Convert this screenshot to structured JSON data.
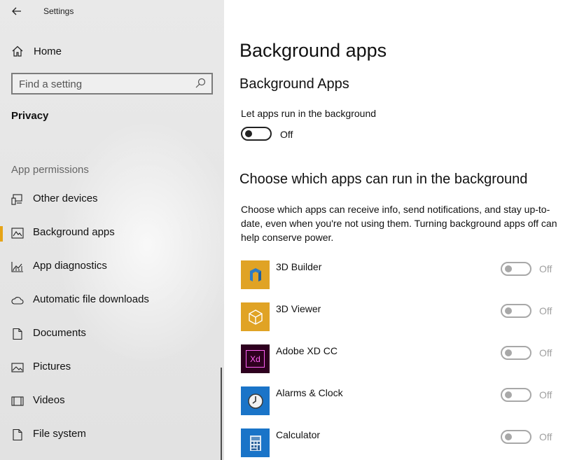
{
  "window": {
    "title": "Settings"
  },
  "sidebar": {
    "home_label": "Home",
    "search": {
      "placeholder": "Find a setting"
    },
    "section_title": "Privacy",
    "group_label": "App permissions",
    "items": [
      {
        "label": "Other devices",
        "icon": "devices-icon",
        "active": false
      },
      {
        "label": "Background apps",
        "icon": "background-apps-icon",
        "active": true
      },
      {
        "label": "App diagnostics",
        "icon": "diagnostics-icon",
        "active": false
      },
      {
        "label": "Automatic file downloads",
        "icon": "cloud-icon",
        "active": false
      },
      {
        "label": "Documents",
        "icon": "document-icon",
        "active": false
      },
      {
        "label": "Pictures",
        "icon": "picture-icon",
        "active": false
      },
      {
        "label": "Videos",
        "icon": "video-icon",
        "active": false
      },
      {
        "label": "File system",
        "icon": "file-icon",
        "active": false
      }
    ],
    "accent_color": "#e6a417"
  },
  "main": {
    "page_title": "Background apps",
    "section1": {
      "heading": "Background Apps",
      "setting_label": "Let apps run in the background",
      "toggle_state": "Off"
    },
    "section2": {
      "heading": "Choose which apps can run in the background",
      "description": "Choose which apps can receive info, send notifications, and stay up-to-date, even when you're not using them. Turning background apps off can help conserve power."
    },
    "apps": [
      {
        "name": "3D Builder",
        "state": "Off",
        "tile_color": "#e0a325",
        "icon": "3d-builder-icon"
      },
      {
        "name": "3D Viewer",
        "state": "Off",
        "tile_color": "#e0a325",
        "icon": "3d-viewer-icon"
      },
      {
        "name": "Adobe XD CC",
        "state": "Off",
        "tile_color": "#2e001f",
        "icon": "adobe-xd-icon",
        "icon_text": "Xd"
      },
      {
        "name": "Alarms & Clock",
        "state": "Off",
        "tile_color": "#1a74c8",
        "icon": "clock-icon"
      },
      {
        "name": "Calculator",
        "state": "Off",
        "tile_color": "#1a74c8",
        "icon": "calculator-icon"
      }
    ]
  }
}
